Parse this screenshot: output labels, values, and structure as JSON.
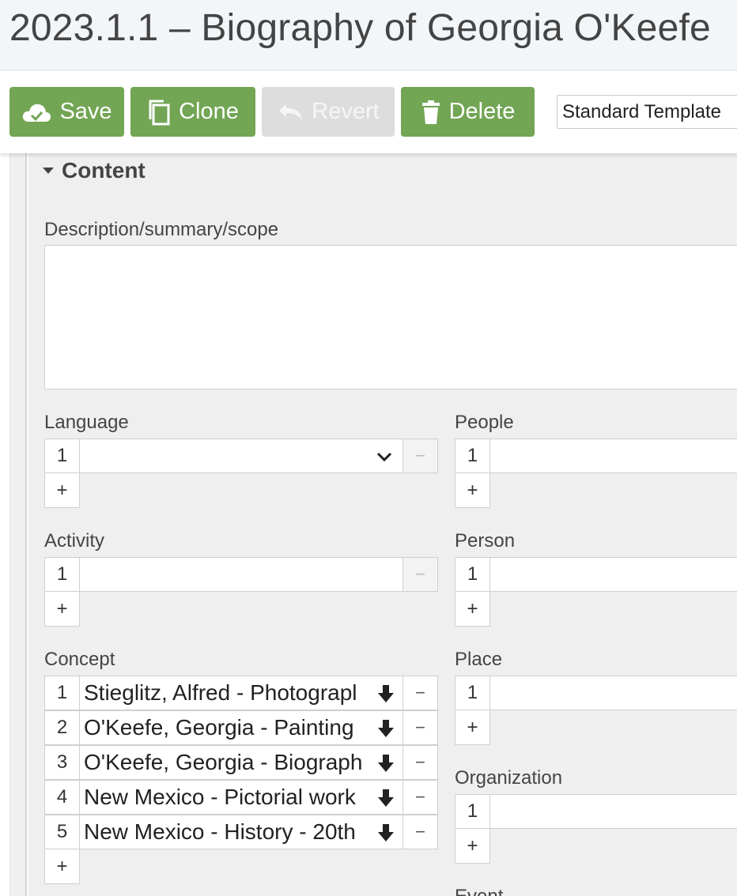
{
  "title": "2023.1.1 – Biography of Georgia O'Keefe",
  "toolbar": {
    "save_label": "Save",
    "clone_label": "Clone",
    "revert_label": "Revert",
    "delete_label": "Delete",
    "template_value": "Standard Template"
  },
  "section": {
    "title": "Content"
  },
  "fields": {
    "description_label": "Description/summary/scope",
    "language_label": "Language",
    "activity_label": "Activity",
    "concept_label": "Concept",
    "people_label": "People",
    "person_label": "Person",
    "place_label": "Place",
    "organization_label": "Organization",
    "event_label": "Event"
  },
  "repeat": {
    "row1": "1",
    "plus": "+",
    "minus": "−"
  },
  "concepts": [
    {
      "n": "1",
      "value": "Stieglitz, Alfred - Photograpl"
    },
    {
      "n": "2",
      "value": "O'Keefe, Georgia - Painting"
    },
    {
      "n": "3",
      "value": "O'Keefe, Georgia - Biograph"
    },
    {
      "n": "4",
      "value": "New Mexico - Pictorial work"
    },
    {
      "n": "5",
      "value": "New Mexico - History - 20th"
    }
  ],
  "colors": {
    "button_green": "#72a554",
    "button_disabled": "#dddddd",
    "panel_bg": "#efefef"
  }
}
